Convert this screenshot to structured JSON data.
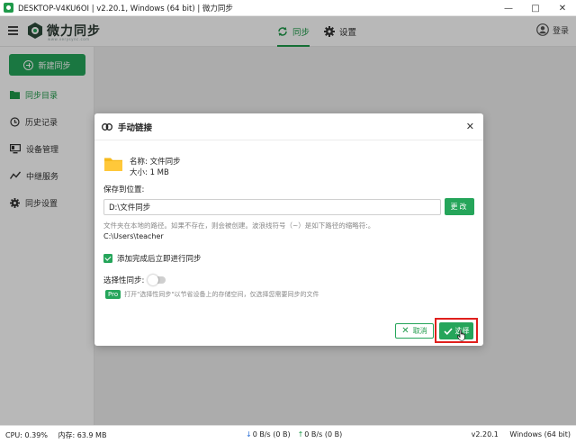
{
  "window": {
    "title": "DESKTOP-V4KU6OI | v2.20.1, Windows (64 bit) | 微力同步",
    "controls": [
      "minimize",
      "maximize",
      "close"
    ]
  },
  "header": {
    "logo_text": "微力同步",
    "logo_subtext": "www.verysync.com",
    "tabs": [
      {
        "label": "同步",
        "icon": "sync-icon",
        "active": true
      },
      {
        "label": "设置",
        "icon": "gear-icon",
        "active": false
      }
    ],
    "login_label": "登录"
  },
  "sidebar": {
    "new_button": "新建同步",
    "items": [
      {
        "label": "同步目录",
        "icon": "folder-icon",
        "active": true
      },
      {
        "label": "历史记录",
        "icon": "history-icon",
        "active": false
      },
      {
        "label": "设备管理",
        "icon": "device-icon",
        "active": false
      },
      {
        "label": "中继服务",
        "icon": "relay-icon",
        "active": false
      },
      {
        "label": "同步设置",
        "icon": "gear-icon",
        "active": false
      }
    ]
  },
  "dialog": {
    "title": "手动链接",
    "name_line": "名称: 文件同步",
    "size_line": "大小: 1 MB",
    "save_to_label": "保存到位置:",
    "path_value": "D:\\文件同步",
    "change_button": "更改",
    "hint": "文件夹在本地的路径。如果不存在，则会被创建。波浪线符号（~）是如下路径的缩略符:。",
    "home_path": "C:\\Users\\teacher",
    "start_sync_checkbox": "添加完成后立即进行同步",
    "start_sync_checked": true,
    "selective_sync_label": "选择性同步:",
    "selective_sync_on": false,
    "pro_badge": "Pro",
    "pro_hint": "打开\"选择性同步\"以节省设备上的存储空间，仅选择您需要同步的文件",
    "cancel_button": "取消",
    "select_button": "选择"
  },
  "status": {
    "cpu": "CPU: 0.39%",
    "memory": "内存: 63.9 MB",
    "down": "0 B/s (0 B)",
    "up": "0 B/s (0 B)",
    "version": "v2.20.1",
    "platform": "Windows (64 bit)"
  },
  "colors": {
    "brand": "#25a55a",
    "highlight": "#e0201d"
  }
}
